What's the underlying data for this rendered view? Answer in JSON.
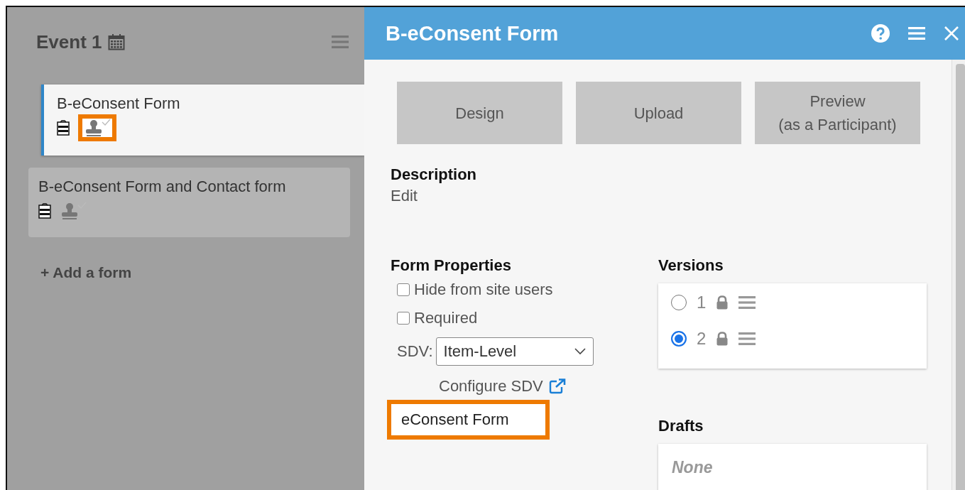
{
  "event": {
    "title": "Event 1"
  },
  "forms": [
    {
      "name": "B-eConsent Form",
      "selected": true,
      "highlighted": true
    },
    {
      "name": "B-eConsent Form and Contact form",
      "selected": false,
      "highlighted": false
    }
  ],
  "add_form": "+ Add a form",
  "panel": {
    "title": "B-eConsent Form",
    "actions": [
      {
        "lines": [
          "Design"
        ]
      },
      {
        "lines": [
          "Upload"
        ]
      },
      {
        "lines": [
          "Preview",
          "(as a Participant)"
        ]
      }
    ],
    "description": {
      "heading": "Description",
      "value": "Edit"
    },
    "properties": {
      "heading": "Form Properties",
      "options": [
        {
          "label": "Hide from site users",
          "checked": false
        },
        {
          "label": "Required",
          "checked": false
        }
      ],
      "sdv": {
        "label": "SDV:",
        "value": "Item-Level"
      },
      "configure_link": "Configure SDV",
      "consent_field": {
        "value": "eConsent Form",
        "highlighted": true
      }
    },
    "versions": {
      "heading": "Versions",
      "items": [
        {
          "number": "1",
          "selected": false
        },
        {
          "number": "2",
          "selected": true
        }
      ]
    },
    "drafts": {
      "heading": "Drafts",
      "empty_text": "None"
    }
  }
}
